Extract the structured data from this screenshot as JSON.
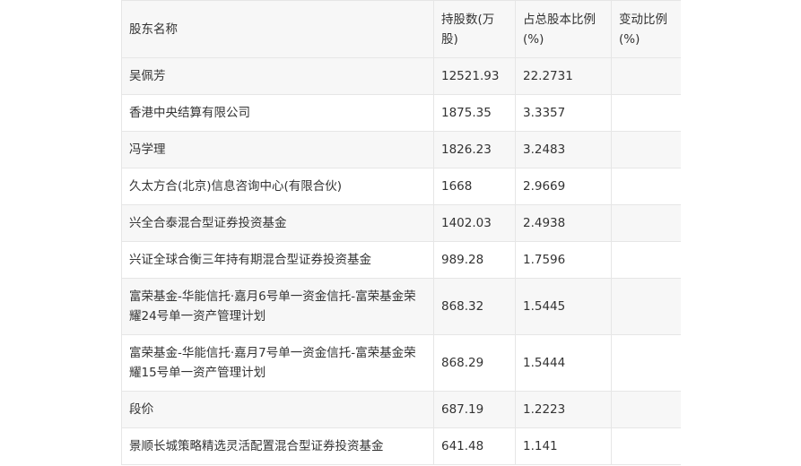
{
  "table": {
    "headers": [
      "股东名称",
      "持股数(万股)",
      "占总股本比例(%)",
      "变动比例(%)"
    ],
    "rows": [
      [
        "吴佩芳",
        "12521.93",
        "22.2731",
        ""
      ],
      [
        "香港中央结算有限公司",
        "1875.35",
        "3.3357",
        ""
      ],
      [
        "冯学理",
        "1826.23",
        "3.2483",
        ""
      ],
      [
        "久太方合(北京)信息咨询中心(有限合伙)",
        "1668",
        "2.9669",
        ""
      ],
      [
        "兴全合泰混合型证券投资基金",
        "1402.03",
        "2.4938",
        ""
      ],
      [
        "兴证全球合衡三年持有期混合型证券投资基金",
        "989.28",
        "1.7596",
        ""
      ],
      [
        "富荣基金-华能信托·嘉月6号单一资金信托-富荣基金荣耀24号单一资产管理计划",
        "868.32",
        "1.5445",
        ""
      ],
      [
        "富荣基金-华能信托·嘉月7号单一资金信托-富荣基金荣耀15号单一资产管理计划",
        "868.29",
        "1.5444",
        ""
      ],
      [
        "段伱",
        "687.19",
        "1.2223",
        ""
      ],
      [
        "景顺长城策略精选灵活配置混合型证券投资基金",
        "641.48",
        "1.141",
        ""
      ]
    ]
  }
}
